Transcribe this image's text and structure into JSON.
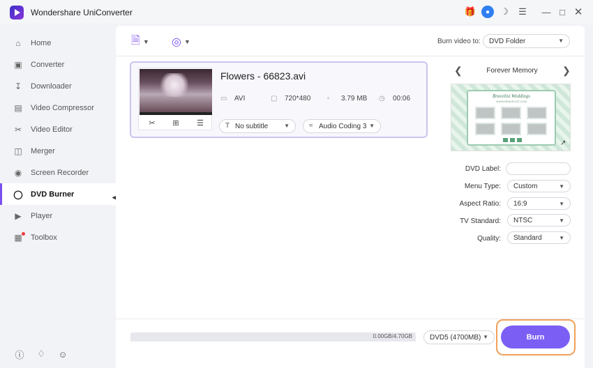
{
  "app": {
    "title": "Wondershare UniConverter",
    "icons": [
      "app-logo",
      "gift-icon",
      "user-icon",
      "headset-icon",
      "menu-icon",
      "minimize-icon",
      "maximize-icon",
      "close-icon"
    ]
  },
  "sidebar": {
    "items": [
      {
        "label": "Home",
        "icon": "home-icon"
      },
      {
        "label": "Converter",
        "icon": "converter-icon"
      },
      {
        "label": "Downloader",
        "icon": "downloader-icon"
      },
      {
        "label": "Video Compressor",
        "icon": "compressor-icon"
      },
      {
        "label": "Video Editor",
        "icon": "scissors-icon"
      },
      {
        "label": "Merger",
        "icon": "merger-icon"
      },
      {
        "label": "Screen Recorder",
        "icon": "screen-recorder-icon"
      },
      {
        "label": "DVD Burner",
        "icon": "dvd-icon",
        "active": true
      },
      {
        "label": "Player",
        "icon": "player-icon"
      },
      {
        "label": "Toolbox",
        "icon": "toolbox-icon"
      }
    ],
    "bottom_icons": [
      "help-icon",
      "bell-icon",
      "feedback-icon"
    ]
  },
  "toolbar": {
    "burn_to_label": "Burn video to:",
    "burn_to_value": "DVD Folder"
  },
  "file": {
    "name": "Flowers - 66823.avi",
    "format": "AVI",
    "resolution": "720*480",
    "size": "3.79 MB",
    "duration": "00:06",
    "subtitle": "No subtitle",
    "audio": "Audio Coding 3"
  },
  "theme": {
    "name": "Forever Memory",
    "preview_title": "Bravelist Weddings",
    "preview_subtitle": "WWW.BRAVELIST.COM"
  },
  "settings": {
    "dvd_label": {
      "label": "DVD Label:",
      "value": ""
    },
    "menu_type": {
      "label": "Menu Type:",
      "value": "Custom"
    },
    "aspect_ratio": {
      "label": "Aspect Ratio:",
      "value": "16:9"
    },
    "tv_standard": {
      "label": "TV Standard:",
      "value": "NTSC"
    },
    "quality": {
      "label": "Quality:",
      "value": "Standard"
    }
  },
  "bottom": {
    "capacity_text": "0.00GB/4.70GB",
    "capacity_fraction": 0.0,
    "disc_type": "DVD5 (4700MB)",
    "burn_label": "Burn"
  },
  "colors": {
    "accent": "#7b5ff4",
    "highlight_border": "#f0a05b",
    "active_nav": "#7b4ef0"
  }
}
